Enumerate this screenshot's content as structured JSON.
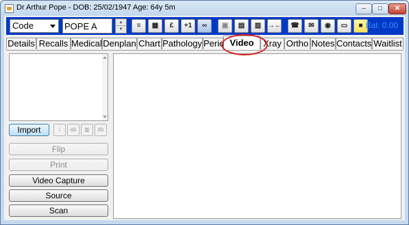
{
  "window": {
    "title": "Dr Arthur Pope - DOB: 25/02/1947 Age: 64y 5m",
    "controls": {
      "minimize": "–",
      "maximize": "□",
      "close": "✕"
    }
  },
  "toolbar": {
    "code_select": "Code",
    "patient_code_value": "POPE A",
    "spinner_up": "▲",
    "spinner_down": "▼",
    "buttons": [
      {
        "name": "notes-icon",
        "glyph": "≡"
      },
      {
        "name": "cash-register-icon",
        "glyph": "▦"
      },
      {
        "name": "pound-icon",
        "glyph": "£"
      },
      {
        "name": "plus-one-icon",
        "glyph": "+1"
      },
      {
        "name": "link-icon",
        "glyph": "∞"
      },
      {
        "name": "save-icon",
        "glyph": "▣"
      },
      {
        "name": "print-preview-icon",
        "glyph": "▤"
      },
      {
        "name": "delete-icon",
        "glyph": "▥"
      },
      {
        "name": "arrows-icon",
        "glyph": "→←"
      },
      {
        "name": "phone-icon",
        "glyph": "☎"
      },
      {
        "name": "letter-icon",
        "glyph": "✉"
      },
      {
        "name": "camera-icon",
        "glyph": "◉"
      },
      {
        "name": "card-icon",
        "glyph": "▭"
      },
      {
        "name": "sticky-note-icon",
        "glyph": "■"
      }
    ],
    "balance": "Bal: 0.00"
  },
  "tabs": [
    "Details",
    "Recalls",
    "Medical",
    "Denplan",
    "Chart",
    "Pathology",
    "Perio",
    "Video",
    "Xray",
    "Ortho",
    "Notes",
    "Contacts",
    "Waitlist"
  ],
  "active_tab": "Video",
  "left_panel": {
    "import": "Import",
    "small_buttons": [
      {
        "name": "info-icon",
        "glyph": "i"
      },
      {
        "name": "edit-icon",
        "glyph": "ab"
      },
      {
        "name": "trash-icon",
        "glyph": "▥"
      },
      {
        "name": "database-icon",
        "glyph": "db"
      }
    ],
    "flip": "Flip",
    "print": "Print",
    "video_capture": "Video Capture",
    "source": "Source",
    "scan": "Scan"
  }
}
